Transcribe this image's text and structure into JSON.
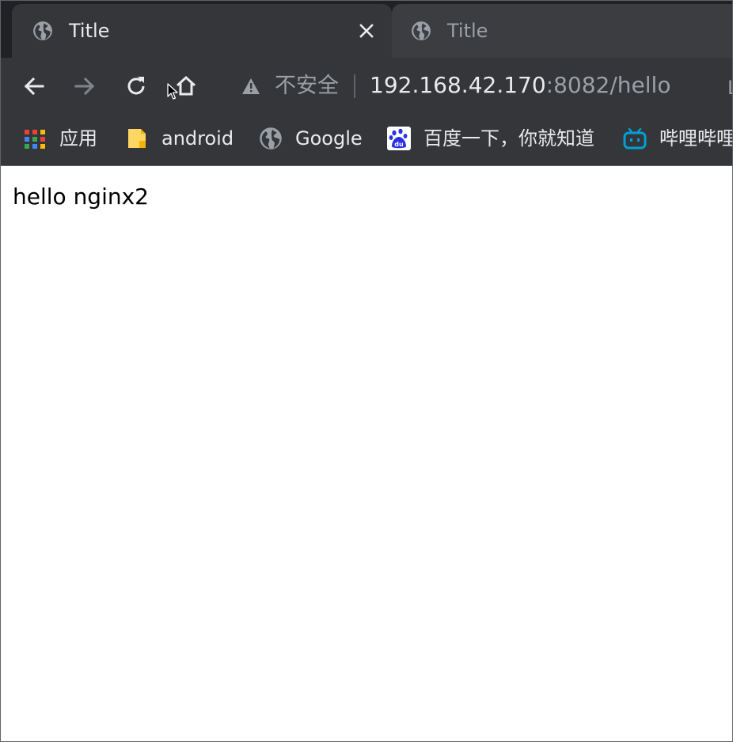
{
  "tabs": [
    {
      "title": "Title",
      "active": true,
      "icon": "globe-icon"
    },
    {
      "title": "Title",
      "active": false,
      "icon": "globe-icon"
    }
  ],
  "toolbar": {
    "security_label": "不安全",
    "url_host": "192.168.42.170",
    "url_rest": ":8082/hello",
    "edge_letter": "L"
  },
  "bookmarks": [
    {
      "label": "应用",
      "icon": "apps-grid-icon"
    },
    {
      "label": "android",
      "icon": "folder-icon"
    },
    {
      "label": "Google",
      "icon": "globe-icon"
    },
    {
      "label": "百度一下，你就知道",
      "icon": "baidu-icon"
    },
    {
      "label": "哔哩哔哩",
      "icon": "bilibili-icon"
    }
  ],
  "page": {
    "text": "hello nginx2"
  },
  "colors": {
    "tab_strip": "#202124",
    "toolbar": "#35363a",
    "text_light": "#e8eaed",
    "text_dim": "#9aa0a6",
    "folder": "#fdd663",
    "baidu": "#2932e1",
    "bilibili": "#00a1d6"
  }
}
